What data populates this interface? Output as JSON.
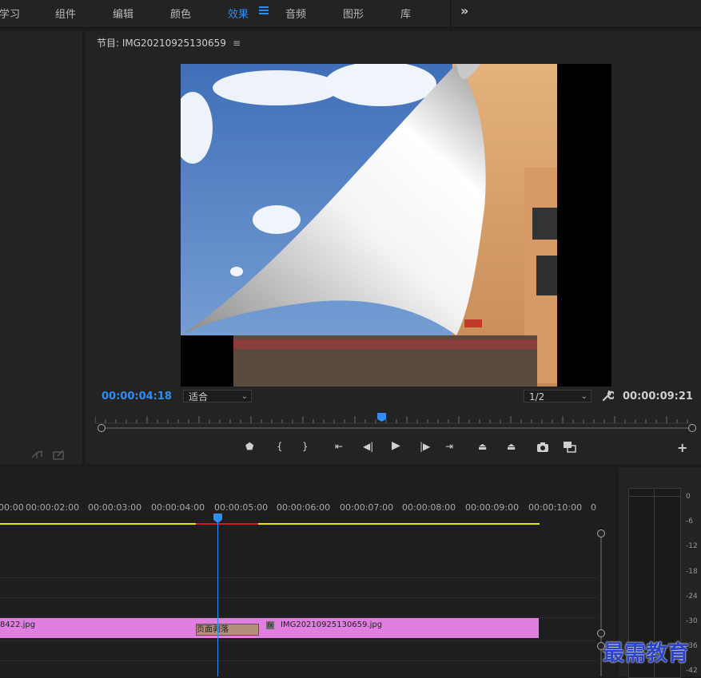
{
  "menu": {
    "items": [
      "学习",
      "组件",
      "编辑",
      "颜色",
      "效果",
      "音频",
      "图形",
      "库"
    ],
    "active": "效果",
    "more_icon": "double-chevron-right"
  },
  "program": {
    "title": "节目: IMG20210925130659",
    "current_timecode": "00:00:04:18",
    "fit_option": "适合",
    "resolution": "1/2",
    "duration_timecode": "00:00:09:21",
    "playhead_percent": 0.47
  },
  "colors": {
    "accent": "#2f8ef5",
    "clip": "#e07fe0",
    "transition": "#b48e7a",
    "work_area": "#e8e800",
    "render_red": "#d01b1b"
  },
  "timeline": {
    "ticks": [
      "00:00",
      "00:00:02:00",
      "00:00:03:00",
      "00:00:04:00",
      "00:00:05:00",
      "00:00:06:00",
      "00:00:07:00",
      "00:00:08:00",
      "00:00:09:00",
      "00:00:10:00",
      "0"
    ],
    "clip_left_label": "8422.jpg",
    "clip_right_label": "IMG20210925130659.jpg",
    "transition_label": "页面剥落",
    "fx_badge": "fx"
  },
  "meter": {
    "db_labels": [
      "0",
      "-6",
      "-12",
      "-18",
      "-24",
      "-30",
      "-36",
      "-42"
    ]
  },
  "watermark": "最需教育"
}
